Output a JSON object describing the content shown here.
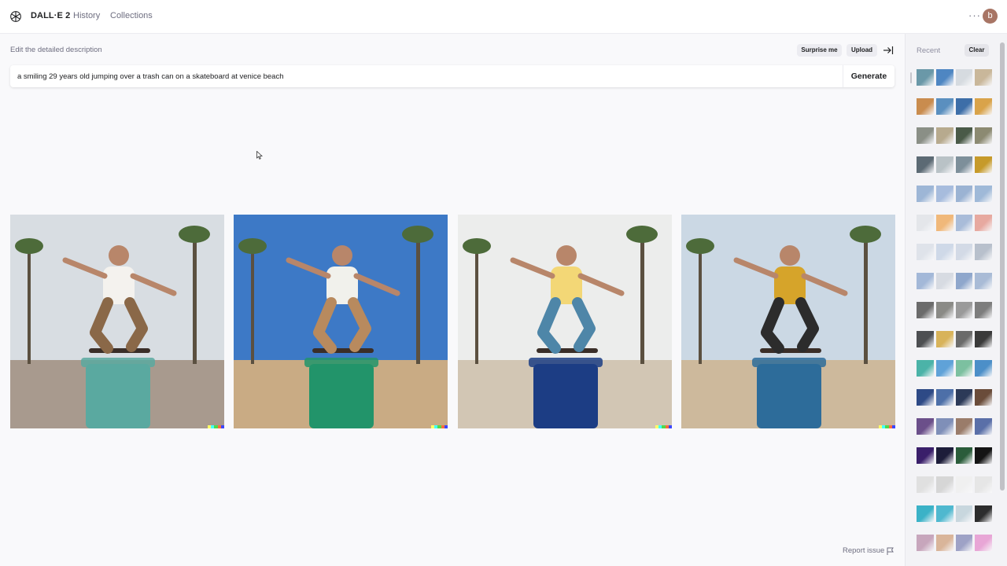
{
  "nav": {
    "brand": "DALL·E 2",
    "history": "History",
    "collections": "Collections",
    "more": "···",
    "avatar_letter": "b"
  },
  "prompt": {
    "label": "Edit the detailed description",
    "surprise": "Surprise me",
    "upload": "Upload",
    "value": "a smiling 29 years old jumping over a trash can on a skateboard at venice beach",
    "generate": "Generate"
  },
  "results": [
    {
      "sky": "#d8dde2",
      "ground": "#a89a8e",
      "bin": "#5aa9a0",
      "shirt": "#f4f2ee",
      "pants": "#8a6848"
    },
    {
      "sky": "#3d79c6",
      "ground": "#c9ab84",
      "bin": "#22946a",
      "shirt": "#f1f1ec",
      "pants": "#b88a5e"
    },
    {
      "sky": "#ecedec",
      "ground": "#d2c6b4",
      "bin": "#1c3d84",
      "shirt": "#f3d776",
      "pants": "#4e86a8"
    },
    {
      "sky": "#cbd8e4",
      "ground": "#cdb99c",
      "bin": "#2d6c9a",
      "shirt": "#d6a42a",
      "pants": "#2c2c2c"
    }
  ],
  "signature_colors": [
    "#ffff66",
    "#42ffff",
    "#51da4c",
    "#ff6e3c",
    "#3c46ff"
  ],
  "recent": {
    "label": "Recent",
    "clear": "Clear",
    "rows": [
      [
        "#6a98a8",
        "#4e86c2",
        "#d6dbe0",
        "#c9b79a"
      ],
      [
        "#c98c4e",
        "#5a8fbf",
        "#3d6ea8",
        "#d9a34a"
      ],
      [
        "#8a8f86",
        "#b7aa8e",
        "#4a5a48",
        "#8c8a72"
      ],
      [
        "#5c6a74",
        "#b9c2c6",
        "#7d8f9a",
        "#c69a2a"
      ],
      [
        "#9db6d6",
        "#a7bcdd",
        "#9bb3d3",
        "#9fb9d8"
      ],
      [
        "#e4e6ea",
        "#f0b87a",
        "#a9bcd9",
        "#e7a9a0"
      ],
      [
        "#dfe3ea",
        "#cfd9e8",
        "#d3dae6",
        "#b8c0cc"
      ],
      [
        "#a3b8d8",
        "#d7dbe2",
        "#8fa7cc",
        "#a9bbd6"
      ],
      [
        "#6b6b6b",
        "#8a8a86",
        "#9a9a9a",
        "#7d7d7d"
      ],
      [
        "#4d4f52",
        "#d8b35a",
        "#6a6a6a",
        "#3a3a3a"
      ],
      [
        "#4bb3a8",
        "#5fa2d8",
        "#7cc0a0",
        "#4c8fc8"
      ],
      [
        "#2e4a86",
        "#4d6fa8",
        "#2c3a58",
        "#6a4c3a"
      ],
      [
        "#6b4f8a",
        "#7f8fb8",
        "#9a7c6a",
        "#5a6fa8"
      ],
      [
        "#3a1f6a",
        "#1d1d3a",
        "#2a5c3a",
        "#141414"
      ],
      [
        "#e0e0e0",
        "#d6d6d6",
        "#f0f0f0",
        "#e6e6e6"
      ],
      [
        "#3bb2c7",
        "#4fb8cf",
        "#c8d7de",
        "#2d2d2d"
      ],
      [
        "#c7a6bc",
        "#d9b59a",
        "#9ea2c6",
        "#e8a6d6"
      ]
    ]
  }
}
